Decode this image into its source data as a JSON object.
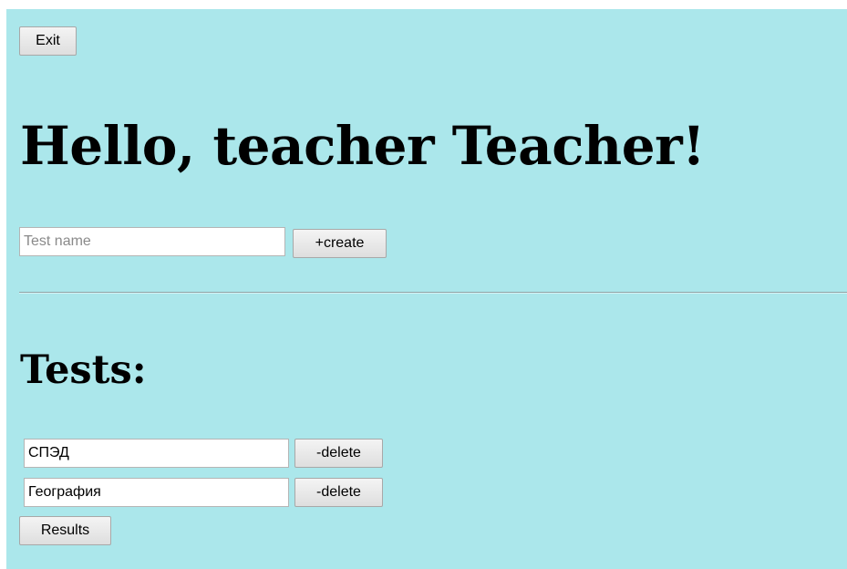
{
  "header": {
    "exit_label": "Exit",
    "greeting": "Hello, teacher Teacher!"
  },
  "create_form": {
    "name_value": "",
    "name_placeholder": "Test name",
    "create_label": "+create"
  },
  "tests": {
    "heading": "Tests:",
    "items": [
      {
        "name": "СПЭД",
        "delete_label": "-delete"
      },
      {
        "name": "География",
        "delete_label": "-delete"
      }
    ],
    "results_label": "Results"
  },
  "colors": {
    "page_background": "#abe7eb"
  }
}
